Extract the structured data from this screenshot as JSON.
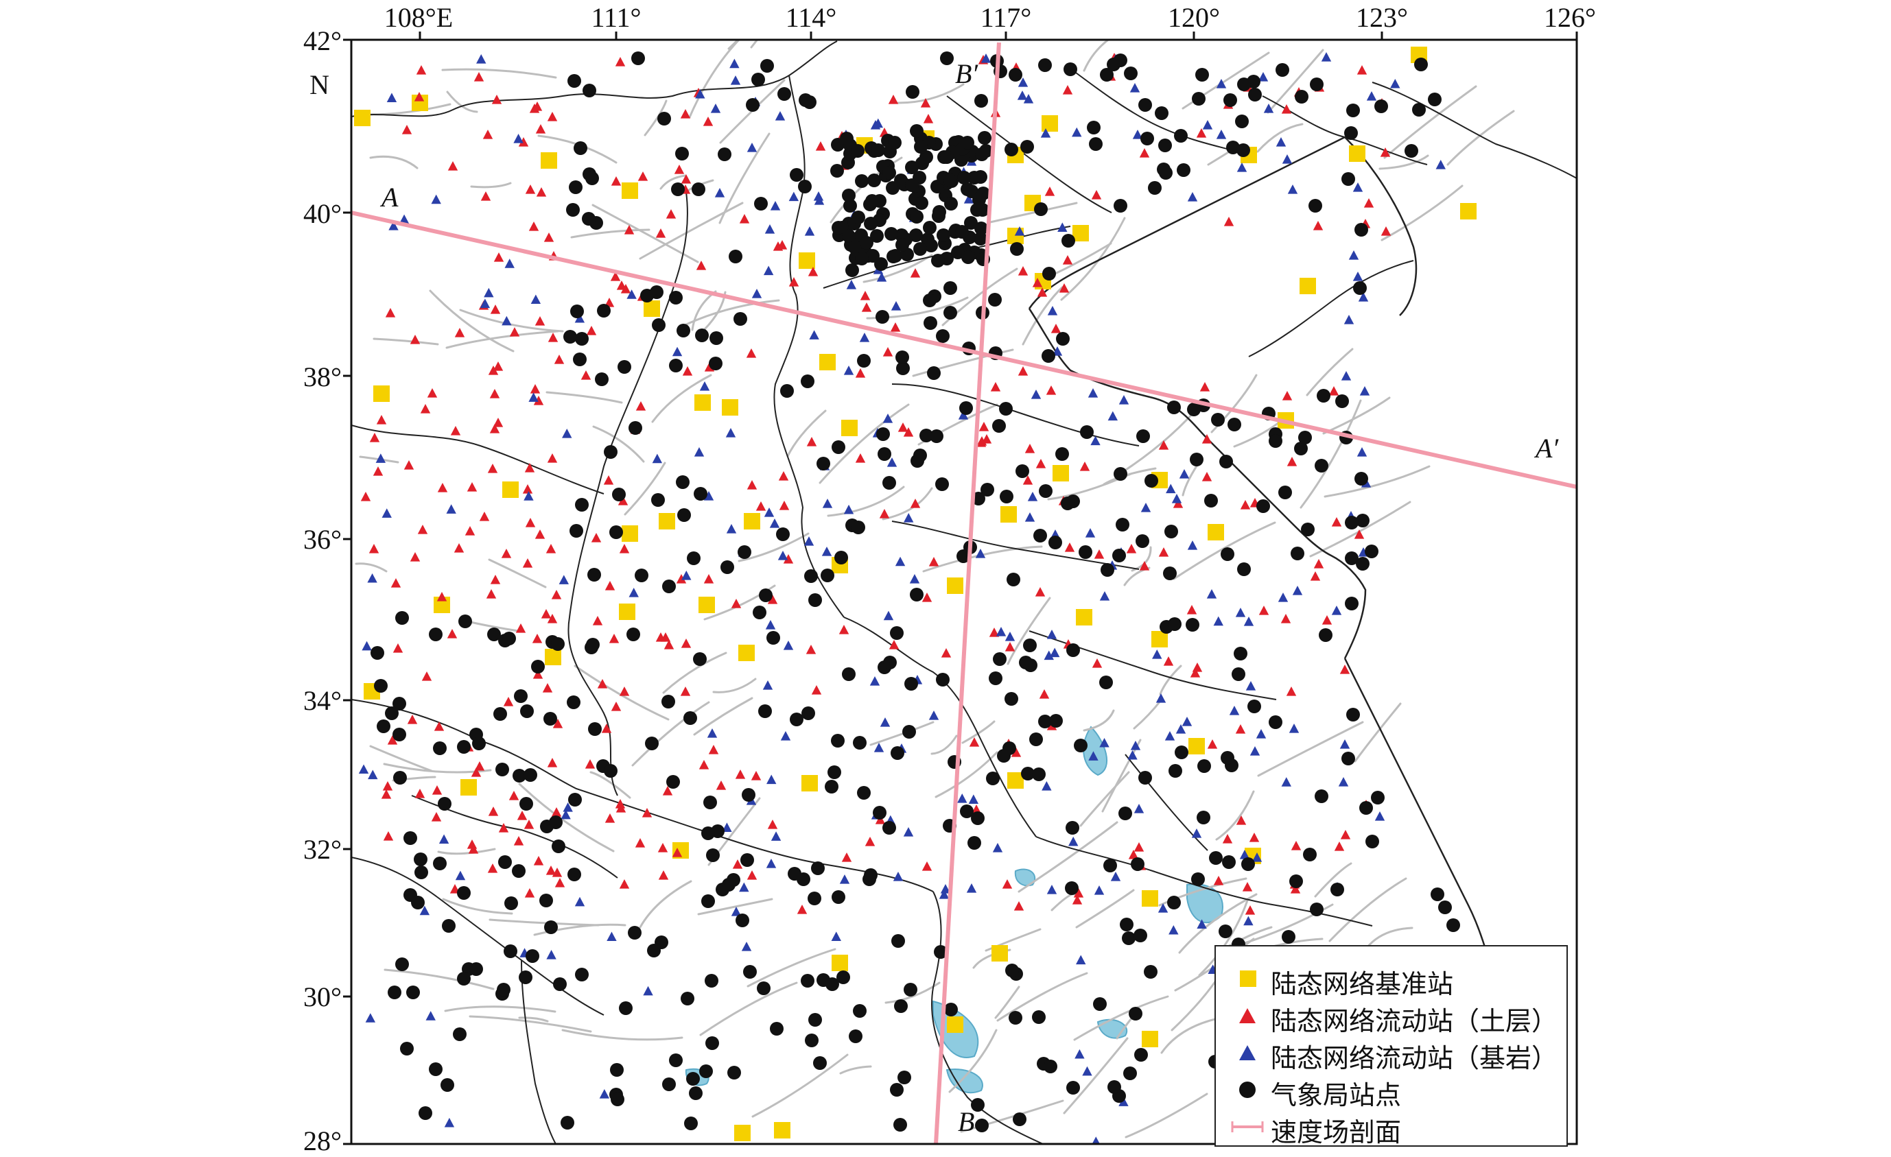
{
  "map": {
    "lat_labels": [
      "42°",
      "N",
      "40°",
      "38°",
      "36°",
      "34°",
      "32°",
      "30°",
      "28°"
    ],
    "lon_labels": [
      "108°E",
      "111°",
      "114°",
      "117°",
      "120°",
      "123°",
      "126°"
    ],
    "profiles": [
      {
        "start_label": "A",
        "end_label": "A′"
      },
      {
        "start_label": "B",
        "end_label": "B′"
      }
    ],
    "colors": {
      "base_station": "#f5d000",
      "mobile_soil": "#e0202a",
      "mobile_bedrock": "#2a3fa8",
      "weather_station": "#111111",
      "profile_line": "#f29aaa",
      "fault": "#bdbdbd",
      "water": "#8ecbe0",
      "boundary": "#222222"
    }
  },
  "legend": {
    "items": [
      {
        "label": "陆态网络基准站",
        "symbol": "square"
      },
      {
        "label": "陆态网络流动站（土层）",
        "symbol": "triangle-red"
      },
      {
        "label": "陆态网络流动站（基岩）",
        "symbol": "triangle-blue"
      },
      {
        "label": "气象局站点",
        "symbol": "circle"
      },
      {
        "label": "速度场剖面",
        "symbol": "profile-line"
      }
    ]
  }
}
